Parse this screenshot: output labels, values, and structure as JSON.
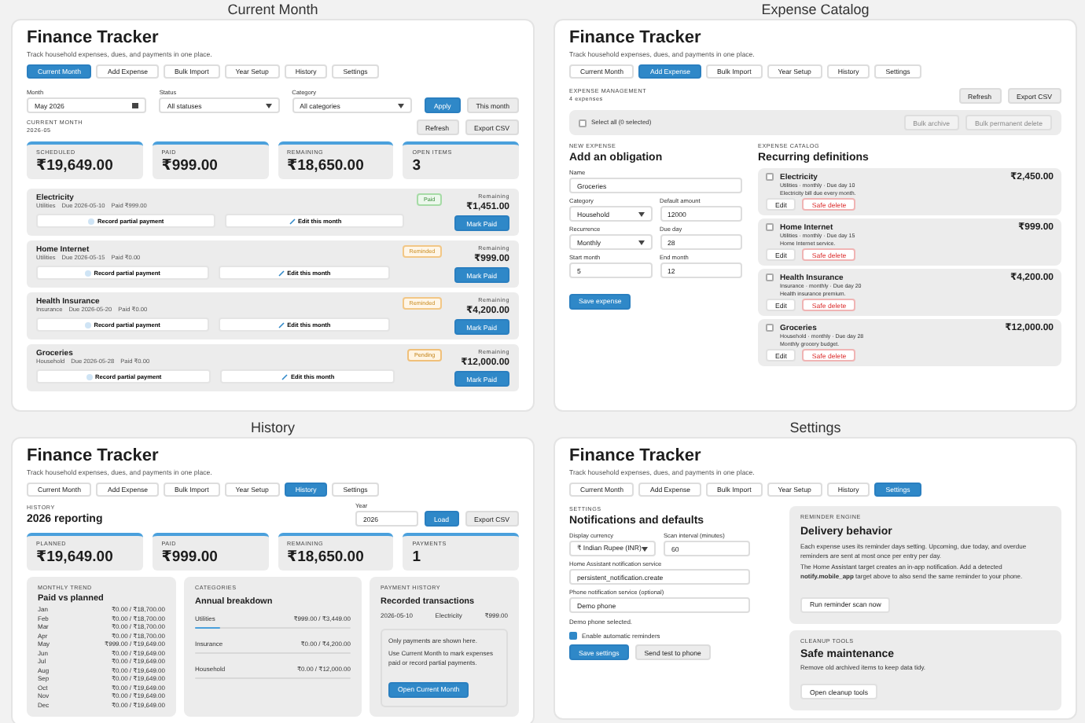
{
  "panels": [
    {
      "kind": "current",
      "caption": "Current Month",
      "app_title": "Finance Tracker",
      "subtitle": "Track household expenses, dues, and payments in one place.",
      "tabs": [
        {
          "label": "Current Month",
          "selected": true
        },
        {
          "label": "Add Expense",
          "selected": false
        },
        {
          "label": "Bulk Import",
          "selected": false
        },
        {
          "label": "Year Setup",
          "selected": false
        },
        {
          "label": "History",
          "selected": false
        },
        {
          "label": "Settings",
          "selected": false
        }
      ],
      "filters": [
        {
          "label": "Month",
          "value": "May 2026",
          "kind": "date"
        },
        {
          "label": "Status",
          "value": "All statuses",
          "kind": "select"
        },
        {
          "label": "Category",
          "value": "All categories",
          "kind": "select"
        }
      ],
      "apply_button": "Apply",
      "this_month_button": "This month",
      "section_label": "CURRENT MONTH",
      "section_value": "2026-05",
      "actions": [
        "Refresh",
        "Export CSV"
      ],
      "stats": [
        {
          "label": "SCHEDULED",
          "value": "₹19,649.00"
        },
        {
          "label": "PAID",
          "value": "₹999.00"
        },
        {
          "label": "REMAINING",
          "value": "₹18,650.00"
        },
        {
          "label": "OPEN ITEMS",
          "value": "3"
        }
      ],
      "items": [
        {
          "name": "Electricity",
          "category": "Utilities",
          "due": "Due 2026-05-10",
          "paid": "Paid ₹999.00",
          "status": {
            "text": "Paid",
            "kind": "paid"
          },
          "remaining_label": "Remaining",
          "remaining": "₹1,451.00",
          "partial": "Record partial payment",
          "edit": "Edit this month",
          "mark": "Mark Paid"
        },
        {
          "name": "Home Internet",
          "category": "Utilities",
          "due": "Due 2026-05-15",
          "paid": "Paid ₹0.00",
          "status": {
            "text": "Reminded",
            "kind": "reminded"
          },
          "remaining_label": "Remaining",
          "remaining": "₹999.00",
          "partial": "Record partial payment",
          "edit": "Edit this month",
          "mark": "Mark Paid"
        },
        {
          "name": "Health Insurance",
          "category": "Insurance",
          "due": "Due 2026-05-20",
          "paid": "Paid ₹0.00",
          "status": {
            "text": "Reminded",
            "kind": "reminded"
          },
          "remaining_label": "Remaining",
          "remaining": "₹4,200.00",
          "partial": "Record partial payment",
          "edit": "Edit this month",
          "mark": "Mark Paid"
        },
        {
          "name": "Groceries",
          "category": "Household",
          "due": "Due 2026-05-28",
          "paid": "Paid ₹0.00",
          "status": {
            "text": "Pending",
            "kind": "pending"
          },
          "remaining_label": "Remaining",
          "remaining": "₹12,000.00",
          "partial": "Record partial payment",
          "edit": "Edit this month",
          "mark": "Mark Paid"
        }
      ]
    },
    {
      "kind": "catalog",
      "caption": "Expense Catalog",
      "app_title": "Finance Tracker",
      "subtitle": "Track household expenses, dues, and payments in one place.",
      "tabs": [
        {
          "label": "Current Month",
          "selected": false
        },
        {
          "label": "Add Expense",
          "selected": true
        },
        {
          "label": "Bulk Import",
          "selected": false
        },
        {
          "label": "Year Setup",
          "selected": false
        },
        {
          "label": "History",
          "selected": false
        },
        {
          "label": "Settings",
          "selected": false
        }
      ],
      "section_label": "EXPENSE MANAGEMENT",
      "section_value": "4 expenses",
      "actions": [
        "Refresh",
        "Export CSV"
      ],
      "select_all": {
        "label": "Select all (0 selected)",
        "checked": false
      },
      "bulk_buttons": [
        {
          "label": "Bulk archive",
          "disabled": true
        },
        {
          "label": "Bulk permanent delete",
          "disabled": true
        }
      ],
      "form": {
        "label": "NEW EXPENSE",
        "title": "Add an obligation",
        "fields": [
          {
            "label": "Name",
            "value": "Groceries",
            "kind": "text"
          },
          {
            "label": "Category",
            "value": "Household",
            "kind": "select"
          },
          {
            "label": "Default amount",
            "value": "12000",
            "kind": "text"
          },
          {
            "label": "Recurrence",
            "value": "Monthly",
            "kind": "select"
          },
          {
            "label": "Due day",
            "value": "28",
            "kind": "text"
          },
          {
            "label": "Start month",
            "value": "5",
            "kind": "text"
          },
          {
            "label": "End month",
            "value": "12",
            "kind": "text"
          }
        ],
        "submit": "Save expense"
      },
      "catalog": {
        "label": "EXPENSE CATALOG",
        "title": "Recurring definitions",
        "items": [
          {
            "name": "Electricity",
            "meta": "Utilities · monthly · Due day 10",
            "description": "Electricity bill due every month.",
            "amount": "₹2,450.00",
            "checked": false,
            "edit": "Edit",
            "delete": "Safe delete"
          },
          {
            "name": "Home Internet",
            "meta": "Utilities · monthly · Due day 15",
            "description": "Home Internet service.",
            "amount": "₹999.00",
            "checked": false,
            "edit": "Edit",
            "delete": "Safe delete"
          },
          {
            "name": "Health Insurance",
            "meta": "Insurance · monthly · Due day 20",
            "description": "Health insurance premium.",
            "amount": "₹4,200.00",
            "checked": false,
            "edit": "Edit",
            "delete": "Safe delete"
          },
          {
            "name": "Groceries",
            "meta": "Household · monthly · Due day 28",
            "description": "Monthly grocery budget.",
            "amount": "₹12,000.00",
            "checked": false,
            "edit": "Edit",
            "delete": "Safe delete"
          }
        ]
      }
    },
    {
      "kind": "history",
      "caption": "History",
      "app_title": "Finance Tracker",
      "subtitle": "Track household expenses, dues, and payments in one place.",
      "tabs": [
        {
          "label": "Current Month",
          "selected": false
        },
        {
          "label": "Add Expense",
          "selected": false
        },
        {
          "label": "Bulk Import",
          "selected": false
        },
        {
          "label": "Year Setup",
          "selected": false
        },
        {
          "label": "History",
          "selected": true
        },
        {
          "label": "Settings",
          "selected": false
        }
      ],
      "section_label": "HISTORY",
      "section_title": "2026 reporting",
      "year": {
        "label": "Year",
        "value": "2026"
      },
      "load_button": "Load",
      "export_button": "Export CSV",
      "stats": [
        {
          "label": "PLANNED",
          "value": "₹19,649.00"
        },
        {
          "label": "PAID",
          "value": "₹999.00"
        },
        {
          "label": "REMAINING",
          "value": "₹18,650.00"
        },
        {
          "label": "PAYMENTS",
          "value": "1"
        }
      ],
      "trend": {
        "label": "MONTHLY TREND",
        "title": "Paid vs planned",
        "rows": [
          {
            "month": "Jan",
            "value": "₹0.00 / ₹18,700.00"
          },
          {
            "month": "Feb",
            "value": "₹0.00 / ₹18,700.00"
          },
          {
            "month": "Mar",
            "value": "₹0.00 / ₹18,700.00"
          },
          {
            "month": "Apr",
            "value": "₹0.00 / ₹18,700.00"
          },
          {
            "month": "May",
            "value": "₹999.00 / ₹19,649.00"
          },
          {
            "month": "Jun",
            "value": "₹0.00 / ₹19,649.00"
          },
          {
            "month": "Jul",
            "value": "₹0.00 / ₹19,649.00"
          },
          {
            "month": "Aug",
            "value": "₹0.00 / ₹19,649.00"
          },
          {
            "month": "Sep",
            "value": "₹0.00 / ₹19,649.00"
          },
          {
            "month": "Oct",
            "value": "₹0.00 / ₹19,649.00"
          },
          {
            "month": "Nov",
            "value": "₹0.00 / ₹19,649.00"
          },
          {
            "month": "Dec",
            "value": "₹0.00 / ₹19,649.00"
          }
        ]
      },
      "categories": {
        "label": "CATEGORIES",
        "title": "Annual breakdown",
        "rows": [
          {
            "name": "Utilities",
            "value": "₹999.00 / ₹3,449.00",
            "level": 0.16
          },
          {
            "name": "Insurance",
            "value": "₹0.00 / ₹4,200.00",
            "level": 0
          },
          {
            "name": "Household",
            "value": "₹0.00 / ₹12,000.00",
            "level": 0
          }
        ]
      },
      "payments": {
        "label": "PAYMENT HISTORY",
        "title": "Recorded transactions",
        "rows": [
          {
            "date": "2026-05-10",
            "name": "Electricity",
            "amount": "₹999.00"
          }
        ],
        "note": [
          "Only payments are shown here.",
          "Use Current Month to mark expenses paid or record partial payments."
        ],
        "button": "Open Current Month"
      }
    },
    {
      "kind": "settings",
      "caption": "Settings",
      "app_title": "Finance Tracker",
      "subtitle": "Track household expenses, dues, and payments in one place.",
      "tabs": [
        {
          "label": "Current Month",
          "selected": false
        },
        {
          "label": "Add Expense",
          "selected": false
        },
        {
          "label": "Bulk Import",
          "selected": false
        },
        {
          "label": "Year Setup",
          "selected": false
        },
        {
          "label": "History",
          "selected": false
        },
        {
          "label": "Settings",
          "selected": true
        }
      ],
      "section_label": "SETTINGS",
      "section_title": "Notifications and defaults",
      "fields": [
        {
          "label": "Display currency",
          "value": "₹ Indian Rupee (INR)",
          "kind": "select"
        },
        {
          "label": "Scan interval (minutes)",
          "value": "60",
          "kind": "text"
        },
        {
          "label": "Home Assistant notification service",
          "value": "persistent_notification.create",
          "kind": "text"
        },
        {
          "label": "Phone notification service (optional)",
          "value": "Demo phone",
          "kind": "text"
        }
      ],
      "hint": "Demo phone selected.",
      "reminders": {
        "label": "Enable automatic reminders",
        "checked": true
      },
      "save_button": "Save settings",
      "test_button": "Send test to phone",
      "engine": {
        "label": "REMINDER ENGINE",
        "title": "Delivery behavior",
        "paragraphs": [
          "Each expense uses its reminder days setting. Upcoming, due today, and overdue reminders are sent at most once per entry per day.",
          "The Home Assistant target creates an in-app notification. Add a detected **notify.mobile_app** target above to also send the same reminder to your phone."
        ],
        "button": "Run reminder scan now"
      },
      "cleanup": {
        "label": "CLEANUP TOOLS",
        "title": "Safe maintenance",
        "text": "Remove old archived items to keep data tidy.",
        "button": "Open cleanup tools"
      }
    }
  ]
}
